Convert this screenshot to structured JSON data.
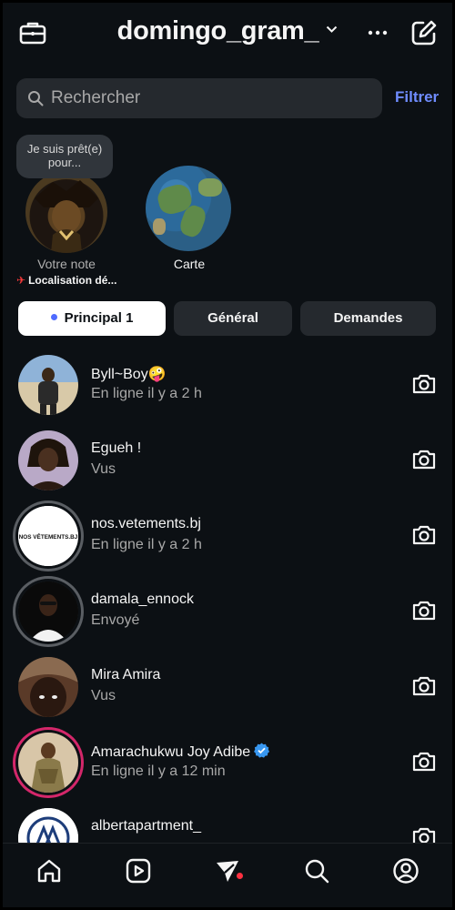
{
  "header": {
    "username": "domingo_gram_",
    "icons": {
      "left": "briefcase-icon",
      "more": "more-horizontal-icon",
      "compose": "compose-icon"
    }
  },
  "search": {
    "placeholder": "Rechercher",
    "filter_label": "Filtrer"
  },
  "notes": {
    "bubble_text": "Je suis prêt(e) pour...",
    "my_note_label": "Votre note",
    "location_text": "Localisation dé...",
    "map_label": "Carte"
  },
  "tabs": [
    {
      "label": "Principal 1",
      "active": true
    },
    {
      "label": "Général",
      "active": false
    },
    {
      "label": "Demandes",
      "active": false
    }
  ],
  "conversations": [
    {
      "name": "Byll~Boy",
      "emoji": "🤪",
      "status": "En ligne il y a 2 h"
    },
    {
      "name": "Egueh !",
      "status": "Vus"
    },
    {
      "name": "nos.vetements.bj",
      "status": "En ligne il y a 2 h",
      "avatar_text": "NOS VÊTEMENTS.BJ"
    },
    {
      "name": "damala_ennock",
      "status": "Envoyé"
    },
    {
      "name": "Mira Amira",
      "status": "Vus"
    },
    {
      "name": "Amarachukwu Joy Adibe",
      "verified": true,
      "status": "En ligne il y a 12 min"
    },
    {
      "name": "albertapartment_",
      "status": ""
    }
  ],
  "colors": {
    "background": "#0c1014",
    "accent": "#6f8cff",
    "notification": "#ff3040",
    "story_ring": "#d4276a"
  },
  "bottom_nav": [
    "home-icon",
    "reels-icon",
    "messages-icon",
    "search-icon",
    "profile-icon"
  ]
}
